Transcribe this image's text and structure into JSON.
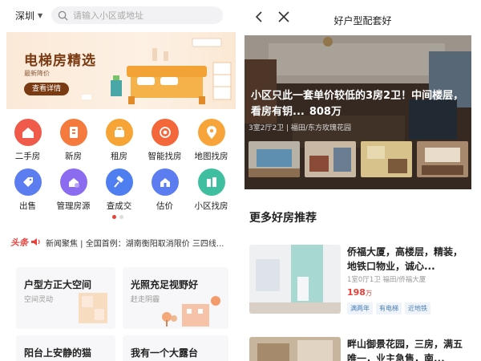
{
  "left": {
    "city": "深圳",
    "search_placeholder": "请输入小区或地址",
    "banner": {
      "title": "电梯房精选",
      "subtitle": "最新降价",
      "button": "查看详情"
    },
    "grid": [
      {
        "label": "二手房",
        "color": "#f05a4a",
        "icon": "house-icon"
      },
      {
        "label": "新房",
        "color": "#f57a3d",
        "icon": "building-icon"
      },
      {
        "label": "租房",
        "color": "#f5a435",
        "icon": "key-bag-icon"
      },
      {
        "label": "智能找房",
        "color": "#f4673a",
        "icon": "target-icon"
      },
      {
        "label": "地图找房",
        "color": "#f7a53a",
        "icon": "map-pin-icon"
      },
      {
        "label": "出售",
        "color": "#5b7df0",
        "icon": "price-tag-icon"
      },
      {
        "label": "管理房源",
        "color": "#8b6cf0",
        "icon": "manage-house-icon"
      },
      {
        "label": "查成交",
        "color": "#4f7ef0",
        "icon": "gavel-icon"
      },
      {
        "label": "估价",
        "color": "#5b7df0",
        "icon": "valuation-icon"
      },
      {
        "label": "小区找房",
        "color": "#3fbf9f",
        "icon": "community-icon"
      }
    ],
    "news": {
      "tag": "头条",
      "text": "新闻聚焦 | 全国首例：湖南衡阳取消限价 三四线..."
    },
    "cards": [
      {
        "title": "户型方正大空间",
        "subtitle": "空间灵动"
      },
      {
        "title": "光照充足视野好",
        "subtitle": "赶走阴霾"
      },
      {
        "title": "阳台上安静的猫",
        "subtitle": ""
      },
      {
        "title": "我有一个大露台",
        "subtitle": ""
      }
    ]
  },
  "right": {
    "title": "好户型配套好",
    "hero": {
      "headline": "小区只此一套单价较低的3房2卫！中间楼层，看房有钥...",
      "price": "808万",
      "meta": "3室2厅2卫 | 福田/东方玫瑰花园"
    },
    "section_title": "更多好房推荐",
    "listings": [
      {
        "title": "侨福大厦，高楼层，精装，地铁口物业，诚心...",
        "meta": "1室0厅1卫 福田/侨福大厦",
        "price": "198",
        "unit": "万",
        "tags": [
          "满两年",
          "有电梯",
          "近地铁"
        ]
      },
      {
        "title": "畔山御景花园，三房，满五唯一，业主急售，南...",
        "meta": "",
        "price": "",
        "unit": "",
        "tags": []
      }
    ]
  },
  "colors": {
    "accent": "#e8413a",
    "banner_brown": "#7a3b12"
  }
}
